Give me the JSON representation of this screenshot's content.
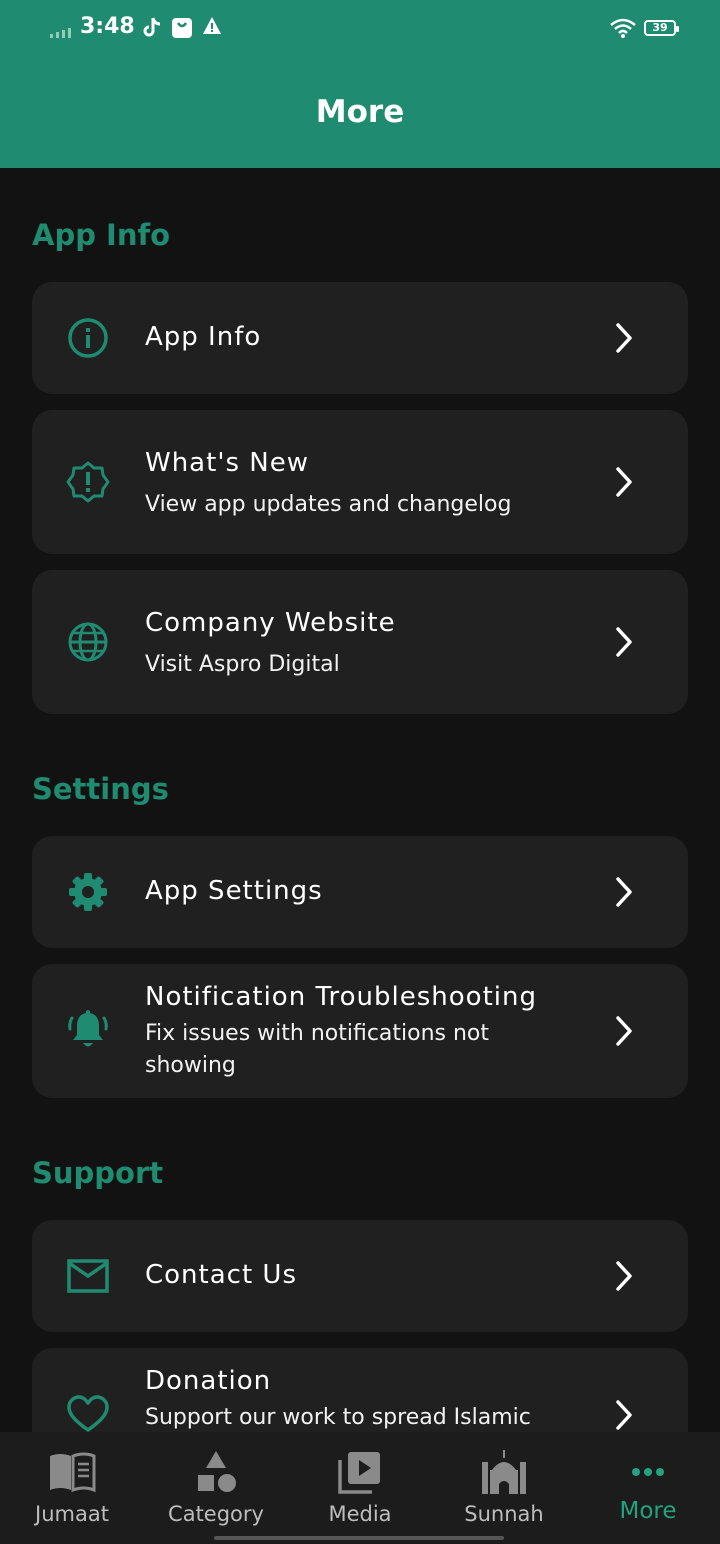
{
  "status": {
    "time": "3:48",
    "battery": "39"
  },
  "appbar": {
    "title": "More"
  },
  "sections": {
    "app_info": {
      "title": "App Info",
      "items": [
        {
          "title": "App Info",
          "subtitle": "",
          "icon": "info-icon"
        },
        {
          "title": "What's New",
          "subtitle": "View app updates and changelog",
          "icon": "new-badge-icon"
        },
        {
          "title": "Company Website",
          "subtitle": "Visit Aspro Digital",
          "icon": "globe-icon"
        }
      ]
    },
    "settings": {
      "title": "Settings",
      "items": [
        {
          "title": "App Settings",
          "subtitle": "",
          "icon": "gear-icon"
        },
        {
          "title": "Notification Troubleshooting",
          "subtitle": "Fix issues with notifications not showing",
          "icon": "bell-icon"
        }
      ]
    },
    "support": {
      "title": "Support",
      "items": [
        {
          "title": "Contact Us",
          "subtitle": "",
          "icon": "mail-icon"
        },
        {
          "title": "Donation",
          "subtitle": "Support our work to spread Islamic",
          "icon": "heart-icon"
        }
      ]
    }
  },
  "bottom_nav": [
    {
      "label": "Jumaat",
      "icon": "book-icon",
      "active": false
    },
    {
      "label": "Category",
      "icon": "shapes-icon",
      "active": false
    },
    {
      "label": "Media",
      "icon": "play-library-icon",
      "active": false
    },
    {
      "label": "Sunnah",
      "icon": "mosque-icon",
      "active": false
    },
    {
      "label": "More",
      "icon": "more-dots-icon",
      "active": true
    }
  ],
  "colors": {
    "accent": "#1f8b70",
    "card": "#202020",
    "background": "#121212",
    "active_nav": "#22a37e"
  }
}
